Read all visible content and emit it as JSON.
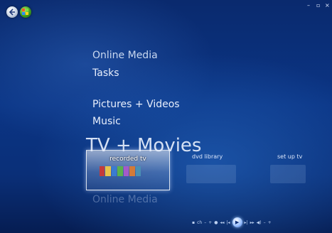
{
  "window": {
    "controls": {
      "minimize_icon": "minimize-icon",
      "restore_icon": "restore-icon",
      "close_icon": "close-icon"
    }
  },
  "nav": {
    "back_icon": "back-arrow-icon",
    "start_icon": "windows-start-icon"
  },
  "menu": {
    "items": [
      {
        "label": "Online Media"
      },
      {
        "label": "Tasks"
      },
      {
        "label": "Pictures + Videos"
      },
      {
        "label": "Music"
      },
      {
        "label": "TV + Movies"
      },
      {
        "label": "Online Media"
      }
    ],
    "selected": "TV + Movies"
  },
  "tv_movies": {
    "tiles": [
      {
        "label": "recorded tv"
      },
      {
        "label": "dvd library"
      },
      {
        "label": "set up tv"
      }
    ],
    "focused": "recorded tv"
  },
  "transport": {
    "buttons": [
      {
        "icon": "stop-icon",
        "glyph": "▪"
      },
      {
        "icon": "channel-up-icon",
        "glyph": "ch"
      },
      {
        "icon": "volume-down-icon",
        "glyph": "–"
      },
      {
        "icon": "volume-up-icon",
        "glyph": "+"
      },
      {
        "icon": "record-icon",
        "glyph": "●"
      },
      {
        "icon": "rewind-icon",
        "glyph": "◂◂"
      },
      {
        "icon": "skip-back-icon",
        "glyph": "|◂"
      },
      {
        "icon": "play-icon",
        "glyph": "▶"
      },
      {
        "icon": "skip-forward-icon",
        "glyph": "▸|"
      },
      {
        "icon": "fast-forward-icon",
        "glyph": "▸▸"
      },
      {
        "icon": "mute-icon",
        "glyph": "◀)"
      },
      {
        "icon": "volume-minus-icon",
        "glyph": "–"
      },
      {
        "icon": "volume-plus-icon",
        "glyph": "+"
      }
    ]
  },
  "colors": {
    "background": "#0b3585",
    "text": "#e7eefc",
    "focus": "#ffffff"
  }
}
